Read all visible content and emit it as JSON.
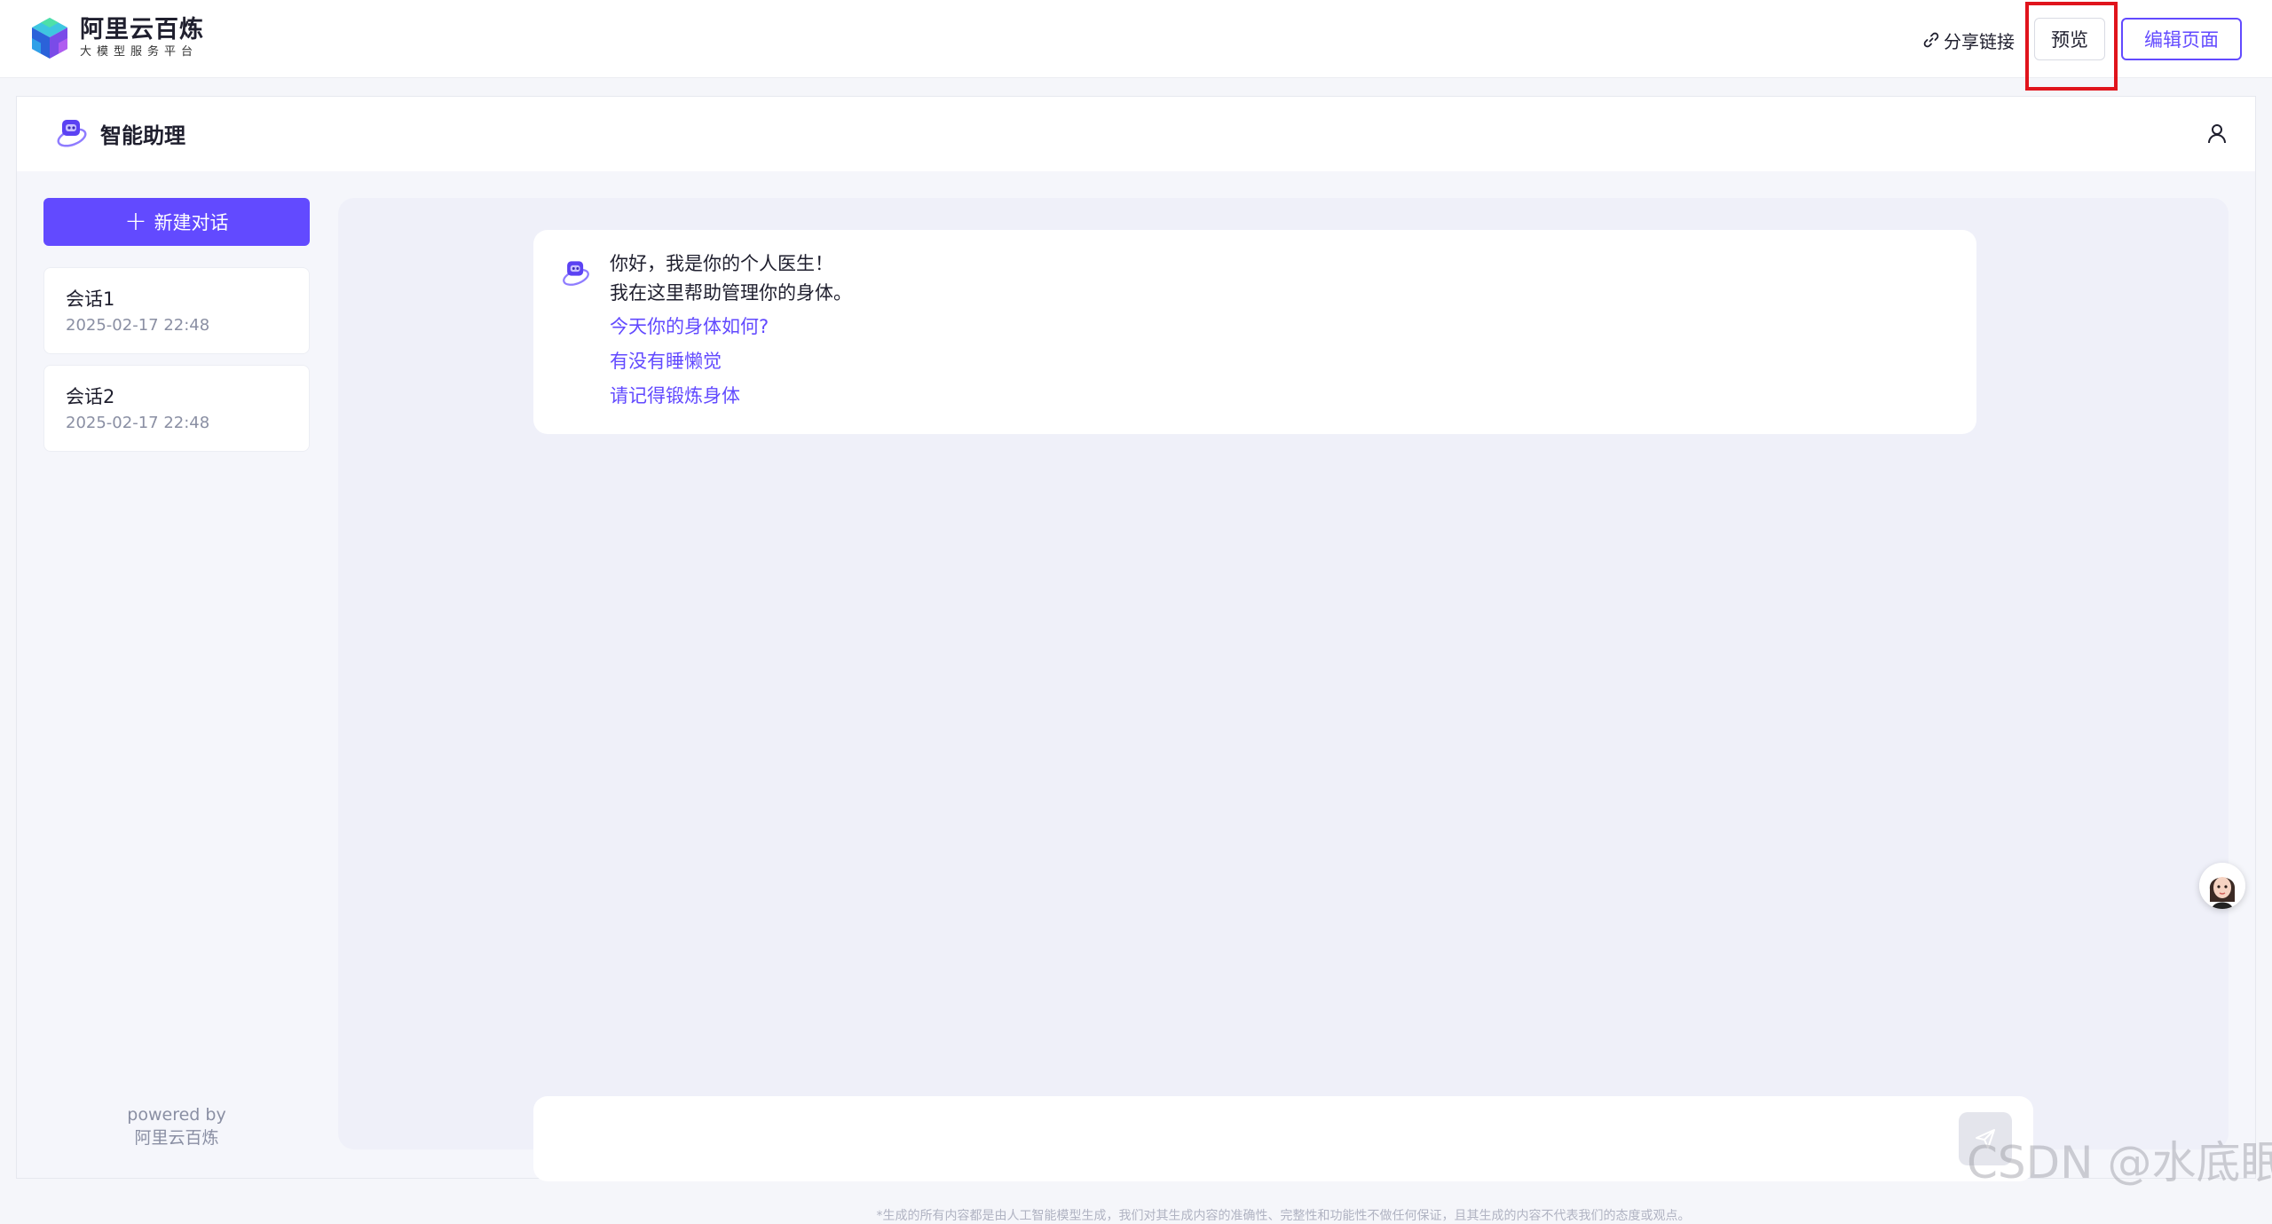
{
  "topbar": {
    "brand_title": "阿里云百炼",
    "brand_sub": "大模型服务平台",
    "share_label": "分享链接",
    "preview_label": "预览",
    "edit_label": "编辑页面"
  },
  "app": {
    "title": "智能助理"
  },
  "sidebar": {
    "new_chat_label": "新建对话",
    "sessions": [
      {
        "title": "会话1",
        "date": "2025-02-17 22:48"
      },
      {
        "title": "会话2",
        "date": "2025-02-17 22:48"
      }
    ],
    "powered_by": "powered by",
    "powered_name": "阿里云百炼"
  },
  "chat": {
    "greeting_line1": "你好，我是你的个人医生！",
    "greeting_line2": "我在这里帮助管理你的身体。",
    "suggestions": [
      "今天你的身体如何?",
      "有没有睡懒觉",
      "请记得锻炼身体"
    ],
    "input_placeholder": "",
    "disclaimer": "*生成的所有内容都是由人工智能模型生成，我们对其生成内容的准确性、完整性和功能性不做任何保证，且其生成的内容不代表我们的态度或观点。"
  },
  "watermark": "CSDN @水底眠",
  "colors": {
    "accent": "#624aff",
    "highlight": "#e0141c"
  }
}
